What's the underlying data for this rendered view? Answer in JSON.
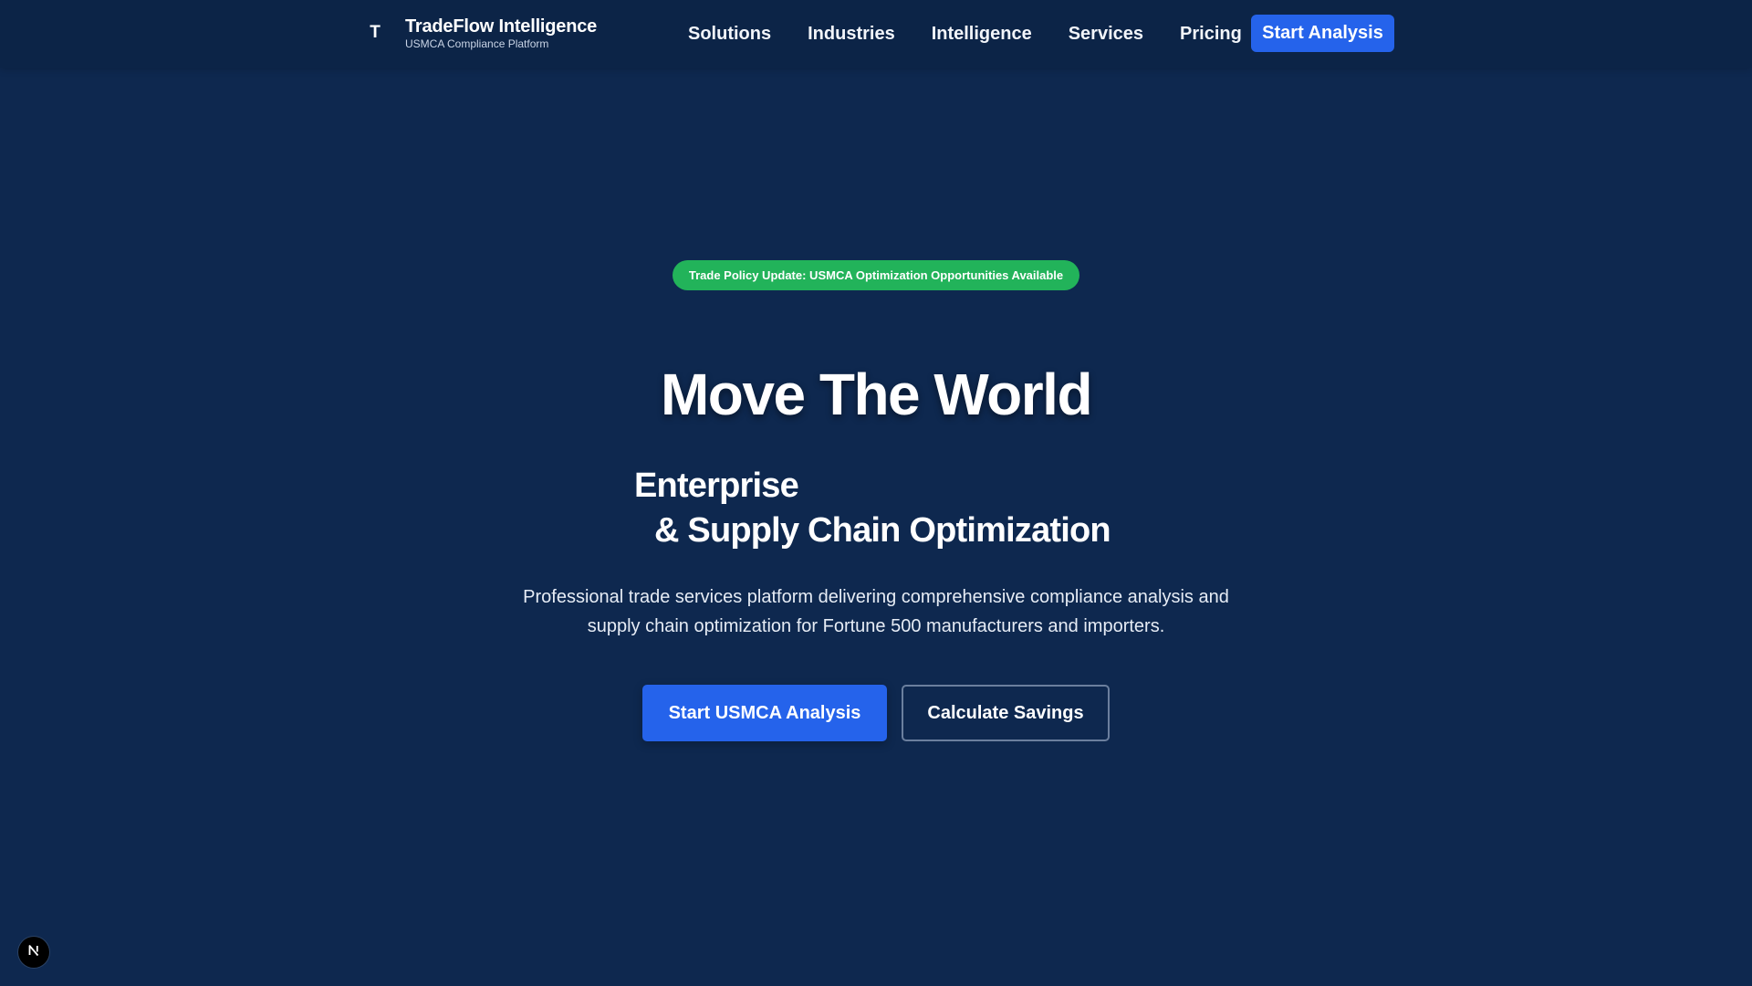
{
  "brand": {
    "logo_letter": "T",
    "name": "TradeFlow Intelligence",
    "tagline": "USMCA Compliance Platform"
  },
  "nav": {
    "links": [
      "Solutions",
      "Industries",
      "Intelligence",
      "Services",
      "Pricing"
    ],
    "cta_label": "Start Analysis"
  },
  "hero": {
    "badge_text": "Trade Policy Update: USMCA Optimization Opportunities Available",
    "title": "Move The World",
    "subtitle_line1": "Enterprise",
    "subtitle_line2": "& Supply Chain Optimization",
    "description": "Professional trade services platform delivering comprehensive compliance analysis and supply chain optimization for Fortune 500 manufacturers and importers.",
    "primary_button": "Start USMCA Analysis",
    "secondary_button": "Calculate Savings"
  },
  "dev_indicator": {
    "icon": "next-logo-icon"
  },
  "colors": {
    "background": "#0e284f",
    "navbar": "#0c2447",
    "accent": "#2563eb",
    "badge": "#22b35a"
  }
}
